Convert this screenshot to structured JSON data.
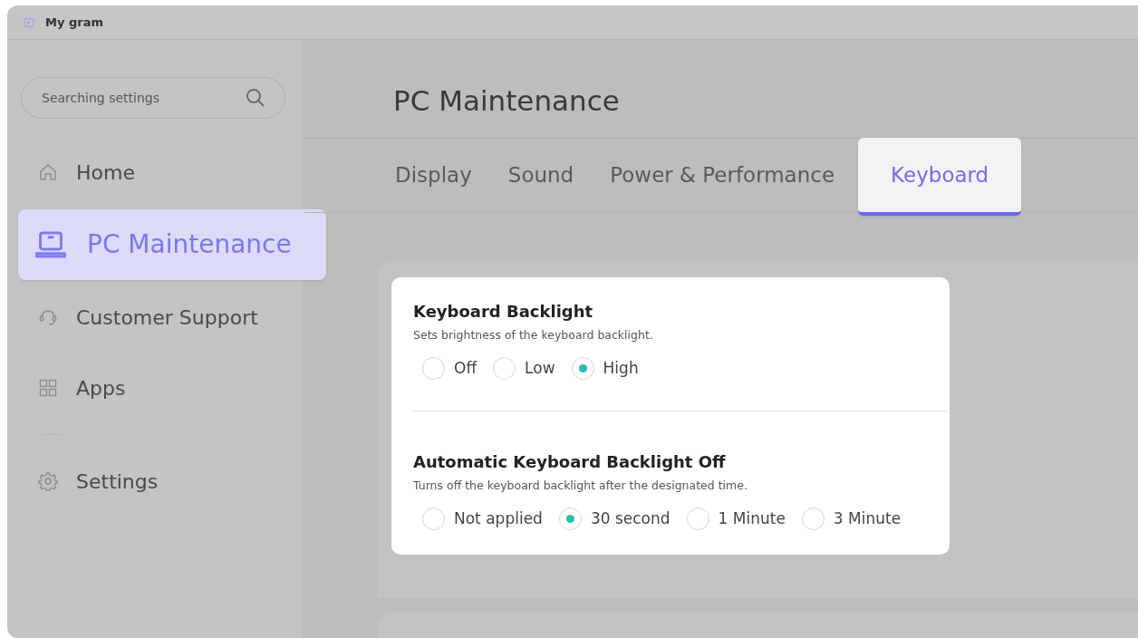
{
  "window": {
    "title": "My gram"
  },
  "search": {
    "placeholder": "Searching settings"
  },
  "nav_items": [
    {
      "label": "Home",
      "kind": "home",
      "selected": false
    },
    {
      "label": "PC Maintenance",
      "kind": "laptop",
      "selected": true
    },
    {
      "label": "Customer Support",
      "kind": "headset",
      "selected": false
    },
    {
      "label": "Apps",
      "kind": "apps",
      "selected": false
    }
  ],
  "nav_footer_items": [
    {
      "label": "Settings",
      "kind": "gear",
      "selected": false
    }
  ],
  "heading": "PC Maintenance",
  "tabs": [
    {
      "label": "Display",
      "selected": false
    },
    {
      "label": "Sound",
      "selected": false
    },
    {
      "label": "Power & Performance",
      "selected": false
    },
    {
      "label": "Keyboard",
      "selected": true
    }
  ],
  "sections": [
    {
      "title": "Keyboard Backlight",
      "description": "Sets brightness of the keyboard backlight.",
      "options": [
        {
          "label": "Off",
          "selected": false
        },
        {
          "label": "Low",
          "selected": false
        },
        {
          "label": "High",
          "selected": true
        }
      ]
    },
    {
      "title": "Automatic Keyboard Backlight Off",
      "description": "Turns off the keyboard backlight after the designated time.",
      "options": [
        {
          "label": "Not applied",
          "selected": false
        },
        {
          "label": "30 second",
          "selected": true
        },
        {
          "label": "1 Minute",
          "selected": false
        },
        {
          "label": "3 Minute",
          "selected": false
        }
      ]
    }
  ]
}
